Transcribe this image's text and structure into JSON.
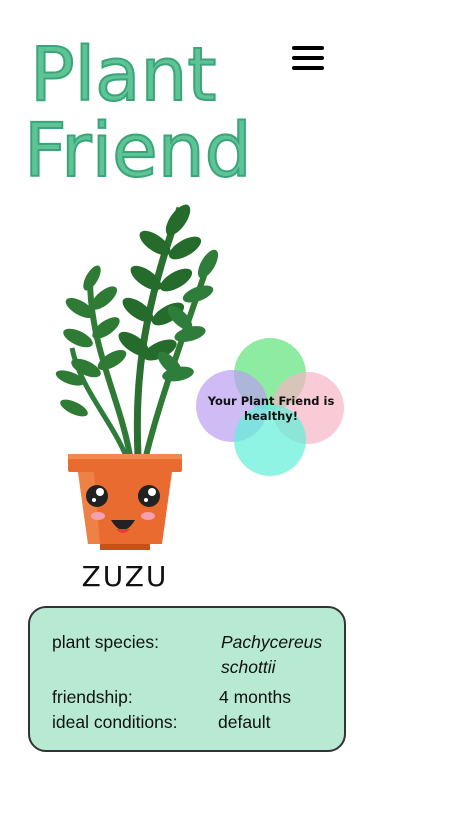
{
  "app": {
    "logo_text_line1": "Plant",
    "logo_text_line2": "Friend",
    "menu_icon": "hamburger-icon"
  },
  "plant": {
    "name": "ZUZU",
    "status_text": "Your Plant Friend is healthy!"
  },
  "info": {
    "species_label": "plant species:",
    "species_line1": "Pachycereus",
    "species_line2": "schottii",
    "friendship_label": "friendship:",
    "friendship_value": "4 months",
    "conditions_label": "ideal conditions:",
    "conditions_value": "default"
  },
  "colors": {
    "logo_green": "#5ec496",
    "card_bg": "#b8ead3",
    "pot_orange": "#ea6b2f",
    "leaf_green": "#2e7d3a"
  }
}
